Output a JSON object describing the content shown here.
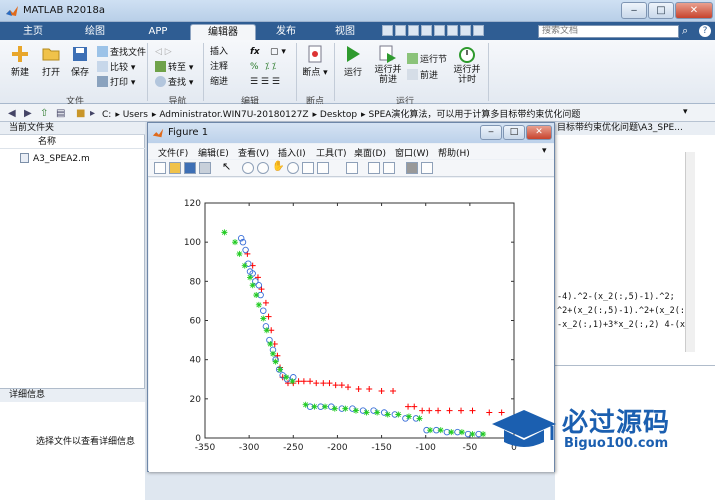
{
  "window": {
    "title": "MATLAB R2018a"
  },
  "tabs": [
    {
      "label": "主页"
    },
    {
      "label": "绘图"
    },
    {
      "label": "APP"
    },
    {
      "label": "编辑器",
      "active": true
    },
    {
      "label": "发布"
    },
    {
      "label": "视图"
    }
  ],
  "search": {
    "placeholder": "搜索文档"
  },
  "ribbon": {
    "file_group": {
      "label": "文件",
      "new": "新建",
      "open": "打开",
      "save": "保存",
      "find_files": "查找文件",
      "compare": "比较",
      "print": "打印"
    },
    "nav_group": {
      "label": "导航",
      "goto": "转至",
      "find": "查找"
    },
    "edit_group": {
      "label": "编辑",
      "insert": "插入",
      "fx": "fx",
      "comment": "注释",
      "comment_pct": "%",
      "indent": "缩进"
    },
    "breakpoint_group": {
      "label": "断点",
      "breakpoints": "断点"
    },
    "run_group": {
      "label": "运行",
      "run": "运行",
      "run_advance": "运行并\n前进",
      "run_section": "运行节",
      "advance": "前进",
      "run_time": "运行并\n计时"
    }
  },
  "address": {
    "segments": [
      "C:",
      "Users",
      "Administrator.WIN7U-20180127Z",
      "Desktop",
      "SPEA演化算法，可以用于计算多目标带约束优化问题"
    ]
  },
  "left_panel": {
    "header": "当前文件夹",
    "column": "名称",
    "file": "A3_SPEA2.m"
  },
  "details_panel": {
    "header": "详细信息",
    "hint": "选择文件以查看详细信息"
  },
  "editor": {
    "tab": "目标带约束优化问题\\A3_SPE...",
    "lines": [
      "-4).^2-(x_2(:,5)-1).^2;",
      "^2+(x_2(:,5)-1).^2+(x_2(:,",
      "-x_2(:,1)+3*x_2(:,2) 4-(x_"
    ]
  },
  "figure": {
    "title": "Figure 1",
    "menu": [
      "文件(F)",
      "编辑(E)",
      "查看(V)",
      "插入(I)",
      "工具(T)",
      "桌面(D)",
      "窗口(W)",
      "帮助(H)"
    ]
  },
  "chart_data": {
    "type": "scatter",
    "title": "",
    "xlabel": "",
    "ylabel": "",
    "xlim": [
      -350,
      0
    ],
    "ylim": [
      0,
      120
    ],
    "xticks": [
      -350,
      -300,
      -250,
      -200,
      -150,
      -100,
      -50,
      0
    ],
    "yticks": [
      0,
      20,
      40,
      60,
      80,
      100,
      120
    ],
    "grid": false,
    "series": [
      {
        "marker": "+",
        "color": "#ff0000",
        "points": [
          [
            -302,
            94
          ],
          [
            -296,
            88
          ],
          [
            -290,
            82
          ],
          [
            -286,
            76
          ],
          [
            -281,
            69
          ],
          [
            -278,
            62
          ],
          [
            -275,
            55
          ],
          [
            -271,
            48
          ],
          [
            -268,
            42
          ],
          [
            -265,
            36
          ],
          [
            -262,
            31
          ],
          [
            -256,
            28
          ],
          [
            -250,
            28
          ],
          [
            -244,
            29
          ],
          [
            -238,
            29
          ],
          [
            -231,
            29
          ],
          [
            -224,
            28
          ],
          [
            -216,
            28
          ],
          [
            -209,
            28
          ],
          [
            -202,
            27
          ],
          [
            -195,
            27
          ],
          [
            -188,
            26
          ],
          [
            -176,
            25
          ],
          [
            -164,
            25
          ],
          [
            -150,
            24
          ],
          [
            -137,
            24
          ],
          [
            -120,
            16
          ],
          [
            -113,
            16
          ],
          [
            -104,
            14
          ],
          [
            -96,
            14
          ],
          [
            -86,
            14
          ],
          [
            -73,
            14
          ],
          [
            -60,
            14
          ],
          [
            -47,
            14
          ],
          [
            -28,
            13
          ],
          [
            -14,
            13
          ]
        ]
      },
      {
        "marker": "o",
        "color": "#3a6fd8",
        "points": [
          [
            -309,
            102
          ],
          [
            -307,
            100
          ],
          [
            -304,
            96
          ],
          [
            -301,
            89
          ],
          [
            -299,
            85
          ],
          [
            -296,
            84
          ],
          [
            -293,
            80
          ],
          [
            -289,
            78
          ],
          [
            -287,
            73
          ],
          [
            -284,
            65
          ],
          [
            -281,
            57
          ],
          [
            -277,
            50
          ],
          [
            -273,
            45
          ],
          [
            -270,
            40
          ],
          [
            -266,
            35
          ],
          [
            -262,
            32
          ],
          [
            -257,
            30
          ],
          [
            -250,
            31
          ],
          [
            -231,
            16
          ],
          [
            -219,
            16
          ],
          [
            -207,
            16
          ],
          [
            -195,
            15
          ],
          [
            -183,
            15
          ],
          [
            -171,
            14
          ],
          [
            -159,
            14
          ],
          [
            -147,
            13
          ],
          [
            -135,
            12
          ],
          [
            -123,
            10
          ],
          [
            -111,
            10
          ],
          [
            -99,
            4
          ],
          [
            -88,
            4
          ],
          [
            -76,
            3
          ],
          [
            -64,
            3
          ],
          [
            -52,
            2
          ],
          [
            -40,
            2
          ]
        ]
      },
      {
        "marker": "*",
        "color": "#22cc22",
        "points": [
          [
            -328,
            105
          ],
          [
            -316,
            100
          ],
          [
            -311,
            94
          ],
          [
            -305,
            88
          ],
          [
            -299,
            82
          ],
          [
            -296,
            78
          ],
          [
            -292,
            73
          ],
          [
            -289,
            68
          ],
          [
            -284,
            61
          ],
          [
            -280,
            55
          ],
          [
            -276,
            48
          ],
          [
            -273,
            43
          ],
          [
            -270,
            39
          ],
          [
            -265,
            35
          ],
          [
            -258,
            31
          ],
          [
            -251,
            29
          ],
          [
            -236,
            17
          ],
          [
            -226,
            16
          ],
          [
            -214,
            16
          ],
          [
            -203,
            15
          ],
          [
            -191,
            15
          ],
          [
            -179,
            14
          ],
          [
            -167,
            13
          ],
          [
            -155,
            13
          ],
          [
            -143,
            12
          ],
          [
            -131,
            12
          ],
          [
            -119,
            11
          ],
          [
            -107,
            10
          ],
          [
            -95,
            4
          ],
          [
            -83,
            4
          ],
          [
            -71,
            3
          ],
          [
            -59,
            3
          ],
          [
            -47,
            2
          ],
          [
            -35,
            2
          ]
        ]
      }
    ]
  },
  "watermark": {
    "title": "必过源码",
    "subtitle": "Biguo100.com"
  }
}
